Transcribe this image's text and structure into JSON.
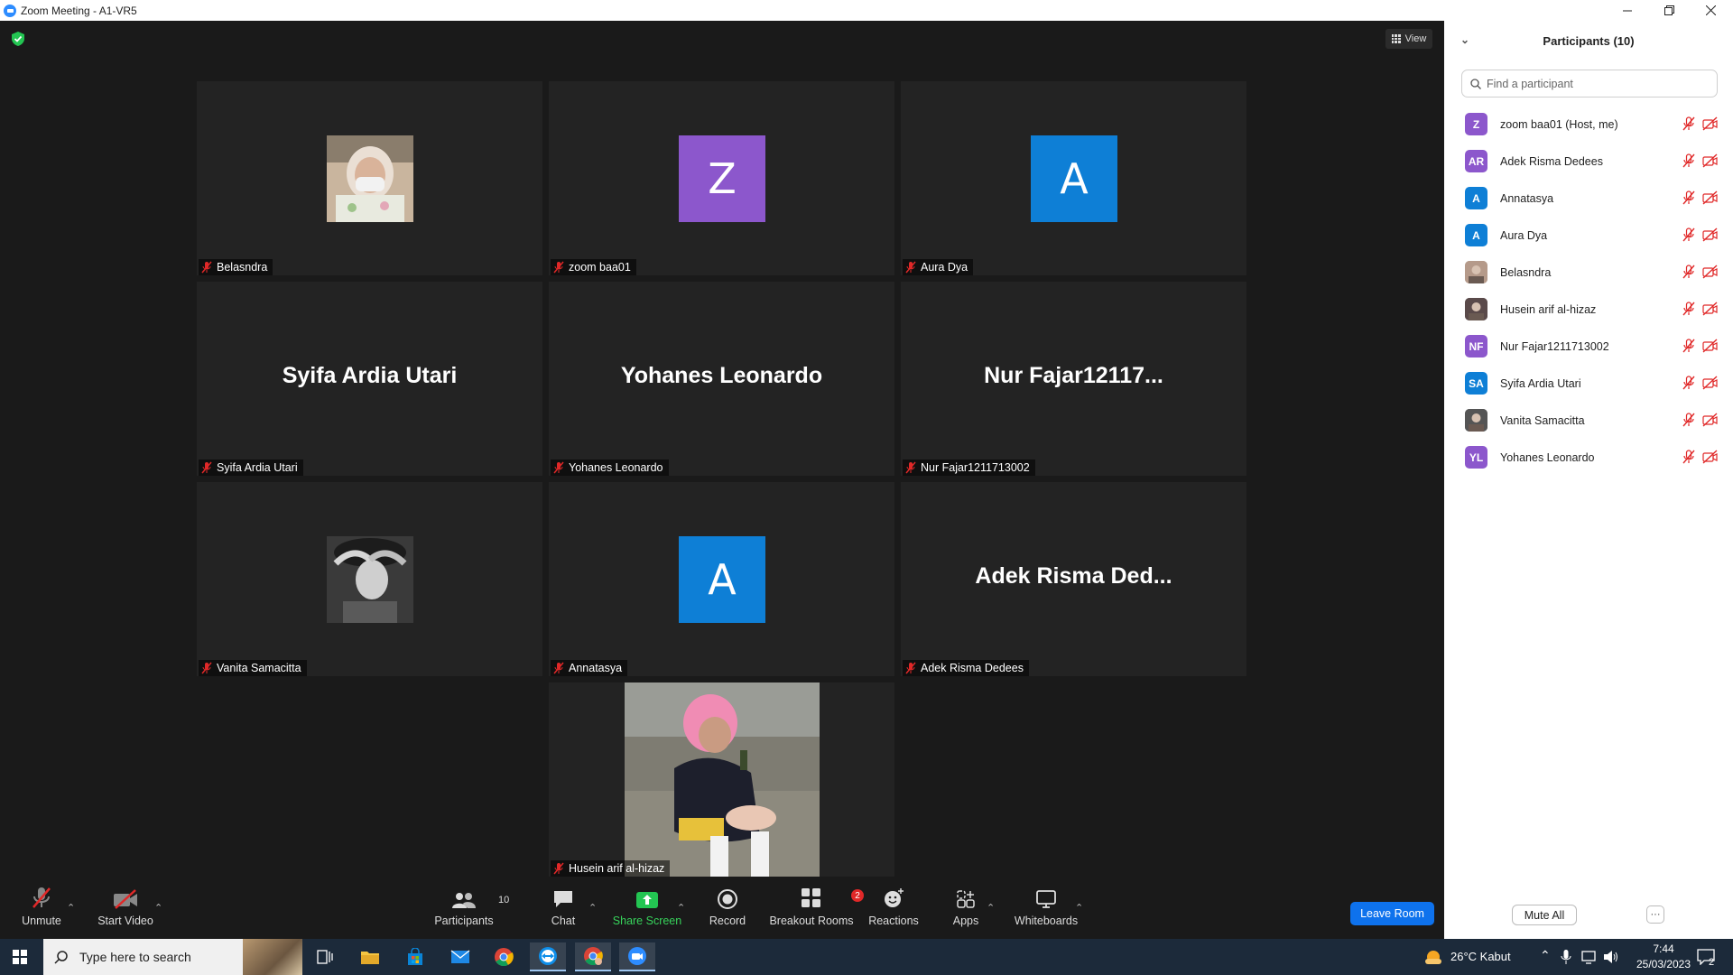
{
  "window": {
    "title": "Zoom Meeting - A1-VR5",
    "controls": [
      "minimize",
      "restore",
      "close"
    ]
  },
  "meeting": {
    "view_label": "View",
    "tiles": [
      {
        "name": "Belasndra",
        "type": "photo",
        "photo": "woman-mask"
      },
      {
        "name": "zoom baa01",
        "type": "avatar",
        "letter": "Z",
        "color": "#8c57cc"
      },
      {
        "name": "Aura Dya",
        "type": "avatar",
        "letter": "A",
        "color": "#0e7fd6"
      },
      {
        "name": "Syifa Ardia Utari",
        "type": "text",
        "display": "Syifa Ardia Utari"
      },
      {
        "name": "Yohanes Leonardo",
        "type": "text",
        "display": "Yohanes Leonardo"
      },
      {
        "name": "Nur Fajar1211713002",
        "type": "text",
        "display": "Nur  Fajar12117..."
      },
      {
        "name": "Vanita Samacitta",
        "type": "photo",
        "photo": "woman-bw"
      },
      {
        "name": "Annatasya",
        "type": "avatar",
        "letter": "A",
        "color": "#0e7fd6"
      },
      {
        "name": "Adek Risma Dedees",
        "type": "text",
        "display": "Adek Risma Ded..."
      },
      {
        "name": "Husein arif al-hizaz",
        "type": "video",
        "photo": "cosplay"
      }
    ]
  },
  "toolbar": {
    "unmute": "Unmute",
    "start_video": "Start Video",
    "participants": "Participants",
    "participants_count": "10",
    "chat": "Chat",
    "share_screen": "Share Screen",
    "record": "Record",
    "breakout_rooms": "Breakout Rooms",
    "breakout_badge": "2",
    "reactions": "Reactions",
    "apps": "Apps",
    "whiteboards": "Whiteboards",
    "leave_room": "Leave Room"
  },
  "panel": {
    "title": "Participants (10)",
    "search_placeholder": "Find a participant",
    "participants": [
      {
        "name": "zoom baa01 (Host, me)",
        "initials": "Z",
        "color": "#8c57cc"
      },
      {
        "name": "Adek Risma Dedees",
        "initials": "AR",
        "color": "#8c57cc"
      },
      {
        "name": "Annatasya",
        "initials": "A",
        "color": "#0e7fd6"
      },
      {
        "name": "Aura Dya",
        "initials": "A",
        "color": "#0e7fd6"
      },
      {
        "name": "Belasndra",
        "initials": "",
        "color": "#b59a8a"
      },
      {
        "name": "Husein arif al-hizaz",
        "initials": "",
        "color": "#5a4a4a"
      },
      {
        "name": "Nur Fajar1211713002",
        "initials": "NF",
        "color": "#8c57cc"
      },
      {
        "name": "Syifa Ardia Utari",
        "initials": "SA",
        "color": "#0e7fd6"
      },
      {
        "name": "Vanita Samacitta",
        "initials": "",
        "color": "#555555"
      },
      {
        "name": "Yohanes Leonardo",
        "initials": "YL",
        "color": "#8c57cc"
      }
    ],
    "mute_all": "Mute All",
    "more": "···"
  },
  "taskbar": {
    "search_text": "Type here to search",
    "weather": "26°C  Kabut",
    "time": "7:44",
    "date": "25/03/2023",
    "notification_count": "2"
  }
}
